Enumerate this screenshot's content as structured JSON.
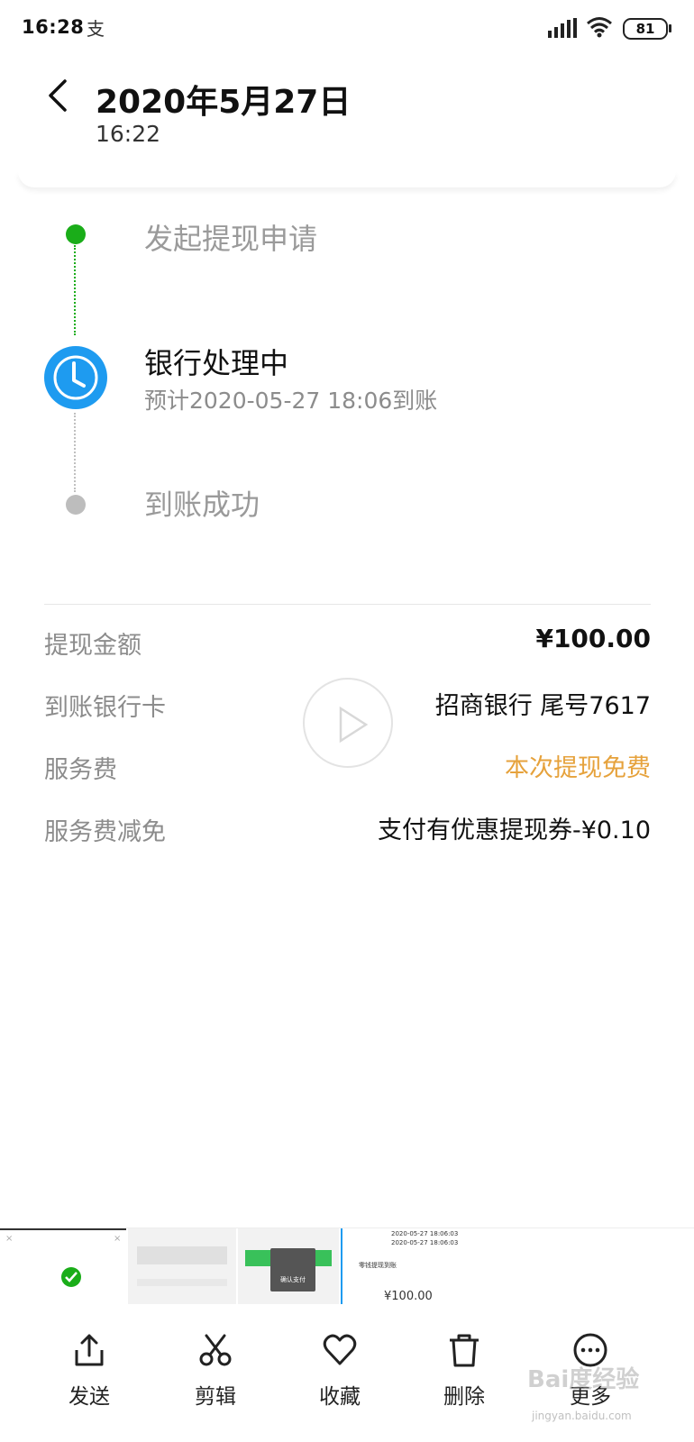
{
  "status_bar": {
    "time": "16:28",
    "app_glyph": "支",
    "battery": "81"
  },
  "header": {
    "title": "2020年5月27日",
    "subtitle": "16:22"
  },
  "timeline": {
    "step1": "发起提现申请",
    "step2": "银行处理中",
    "step2_sub": "预计2020-05-27 18:06到账",
    "step3": "到账成功",
    "colors": {
      "done": "#1aad19",
      "current": "#1e9bf0",
      "pending": "#bdbdbd"
    }
  },
  "details": [
    {
      "label": "提现金额",
      "value": "¥100.00"
    },
    {
      "label": "到账银行卡",
      "value": "招商银行 尾号7617"
    },
    {
      "label": "服务费",
      "value": "本次提现免费"
    },
    {
      "label": "服务费减免",
      "value": "支付有优惠提现券-¥0.10"
    }
  ],
  "thumbnails": {
    "t3_button": "确认支付",
    "t4_line1": "2020-05-27 18:06:03",
    "t4_line2": "2020-05-27 18:06:03",
    "t4_heading": "零钱提现到账",
    "t4_amount": "¥100.00"
  },
  "toolbar": {
    "send": "发送",
    "edit": "剪辑",
    "favorite": "收藏",
    "delete": "删除",
    "more": "更多"
  },
  "watermark": {
    "text": "Bai度经验",
    "sub": "jingyan.baidu.com"
  }
}
